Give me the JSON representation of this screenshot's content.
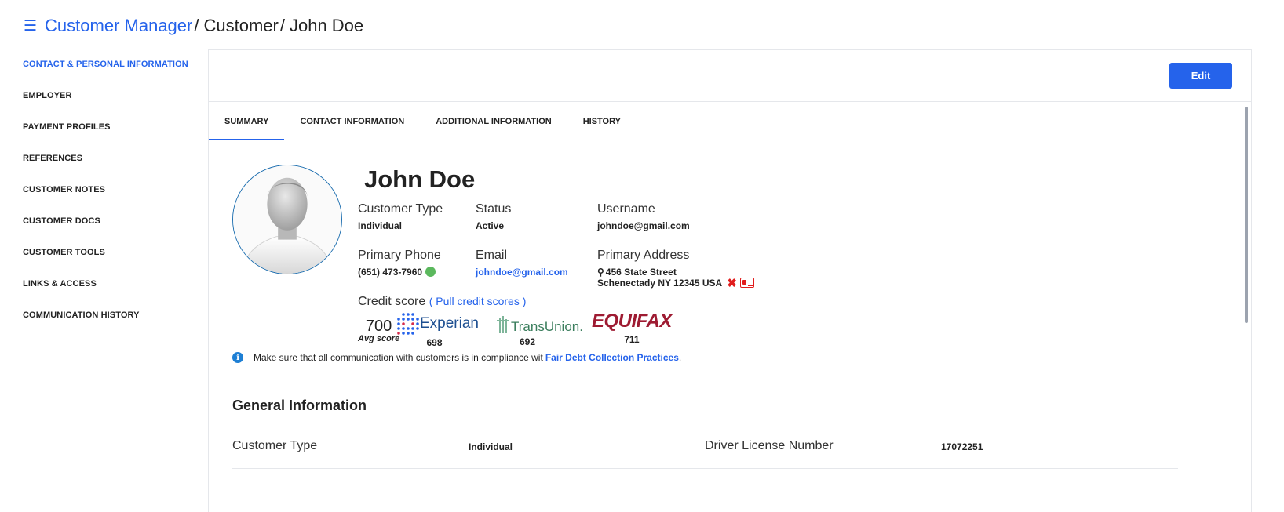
{
  "header": {
    "breadcrumb": [
      "Customer Manager",
      "Customer",
      "John Doe"
    ],
    "separator": "/"
  },
  "sidebar": {
    "items": [
      {
        "label": "CONTACT & PERSONAL INFORMATION",
        "active": true
      },
      {
        "label": "EMPLOYER"
      },
      {
        "label": "PAYMENT PROFILES"
      },
      {
        "label": "REFERENCES"
      },
      {
        "label": "CUSTOMER NOTES"
      },
      {
        "label": "CUSTOMER DOCS"
      },
      {
        "label": "CUSTOMER TOOLS"
      },
      {
        "label": "LINKS & ACCESS"
      },
      {
        "label": "COMMUNICATION HISTORY"
      }
    ]
  },
  "toolbar": {
    "edit_label": "Edit"
  },
  "tabs": [
    {
      "label": "SUMMARY",
      "active": true
    },
    {
      "label": "CONTACT INFORMATION"
    },
    {
      "label": "ADDITIONAL INFORMATION"
    },
    {
      "label": "HISTORY"
    }
  ],
  "profile": {
    "name": "John Doe",
    "customer_type": {
      "label": "Customer Type",
      "value": "Individual"
    },
    "status": {
      "label": "Status",
      "value": "Active"
    },
    "username": {
      "label": "Username",
      "value": "johndoe@gmail.com"
    },
    "primary_phone": {
      "label": "Primary Phone",
      "value": "(651) 473-7960"
    },
    "email": {
      "label": "Email",
      "value": "johndoe@gmail.com"
    },
    "primary_address": {
      "label": "Primary Address",
      "line1": "456 State Street",
      "line2": "Schenectady NY 12345 USA"
    }
  },
  "credit": {
    "label": "Credit score",
    "pull_link": "( Pull credit scores )",
    "avg_score": "700",
    "avg_label": "Avg score",
    "bureaus": [
      {
        "name": "Experian",
        "score": "698"
      },
      {
        "name": "TransUnion.",
        "score": "692"
      },
      {
        "name": "EQUIFAX",
        "score": "711"
      }
    ]
  },
  "notice": {
    "text": "Make sure that all communication with customers is in compliance wit",
    "link": "Fair Debt Collection Practices",
    "suffix": "."
  },
  "general_info": {
    "title": "General Information",
    "rows": [
      {
        "label1": "Customer Type",
        "value1": "Individual",
        "label2": "Driver License Number",
        "value2": "17072251"
      }
    ]
  },
  "colors": {
    "accent": "#2563eb",
    "status_green": "#5bb85d",
    "danger": "#e11d1d"
  }
}
